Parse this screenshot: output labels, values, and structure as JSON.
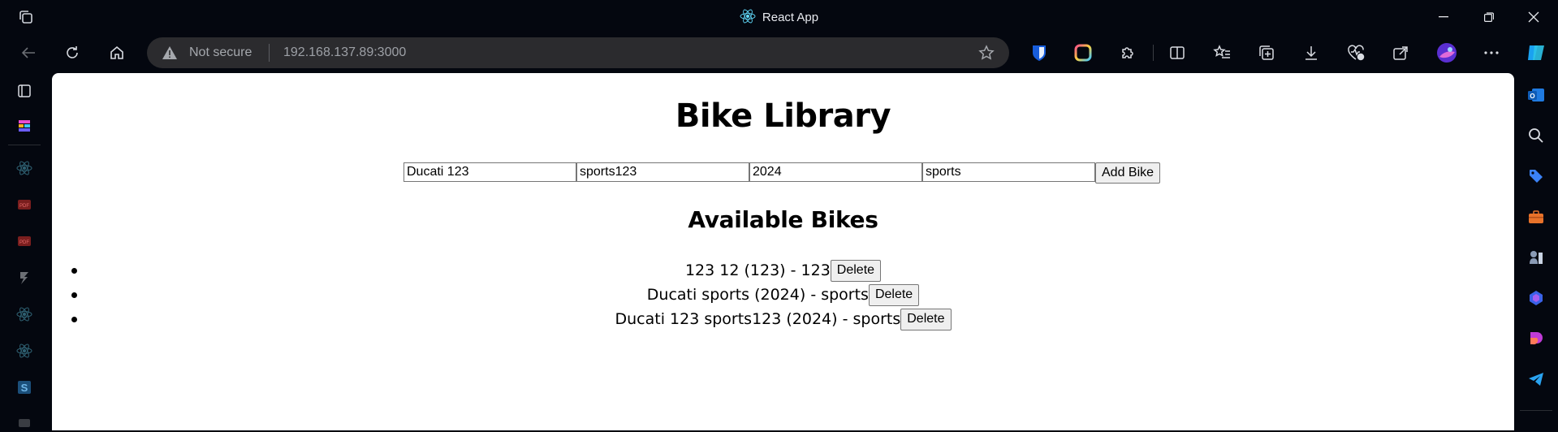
{
  "window": {
    "title": "React App"
  },
  "address_bar": {
    "security_label": "Not secure",
    "url_host": "192.168.137.89",
    "url_port": ":3000"
  },
  "page": {
    "heading": "Bike Library",
    "form": {
      "field1_value": "Ducati 123",
      "field2_value": "sports123",
      "field3_value": "2024",
      "field4_value": "sports",
      "add_label": "Add Bike"
    },
    "list_heading": "Available Bikes",
    "bikes": [
      {
        "text": "123 12 (123) - 123",
        "delete_label": "Delete"
      },
      {
        "text": "Ducati sports (2024) - sports",
        "delete_label": "Delete"
      },
      {
        "text": "Ducati 123 sports123 (2024) - sports",
        "delete_label": "Delete"
      }
    ]
  },
  "colors": {
    "accent": "#3b82f6",
    "chrome_bg": "#04070f",
    "omnibox_bg": "#2b2b2e"
  }
}
